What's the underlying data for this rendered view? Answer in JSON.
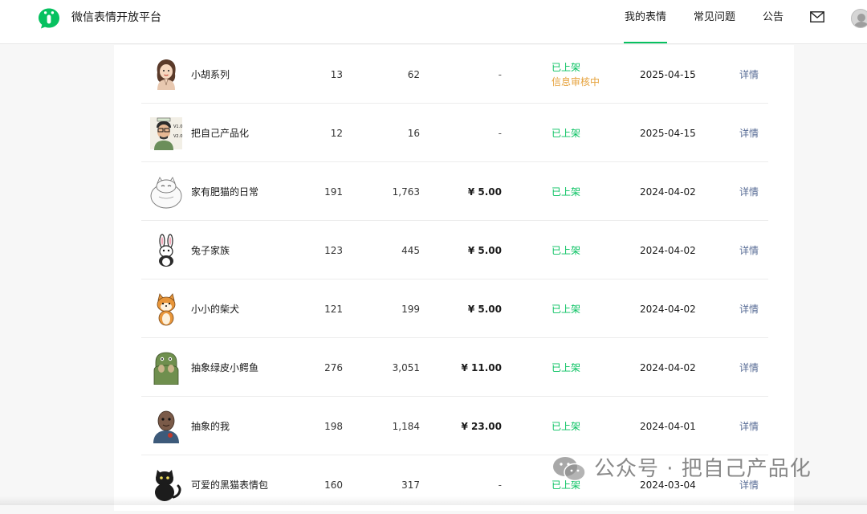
{
  "header": {
    "site_title": "微信表情开放平台",
    "nav": [
      {
        "label": "我的表情",
        "active": true
      },
      {
        "label": "常见问题",
        "active": false
      },
      {
        "label": "公告",
        "active": false
      }
    ],
    "mail_icon": "mail-icon",
    "avatar_icon": "avatar-icon"
  },
  "colors": {
    "brand": "#07c160",
    "status_listed": "#07c160",
    "status_review": "#e6a23c",
    "link": "#576b95"
  },
  "table": {
    "rows": [
      {
        "name": "小胡系列",
        "n1": "13",
        "n2": "62",
        "price": "-",
        "status": "已上架",
        "sub_status": "信息审核中",
        "date": "2025-04-15",
        "action": "详情",
        "thumb_icon": "girl-praying-sticker-icon"
      },
      {
        "name": "把自己产品化",
        "n1": "12",
        "n2": "16",
        "price": "-",
        "status": "已上架",
        "date": "2025-04-15",
        "action": "详情",
        "thumb_icon": "man-with-glasses-sticker-icon"
      },
      {
        "name": "家有肥猫的日常",
        "n1": "191",
        "n2": "1,763",
        "price": "¥ 5.00",
        "status": "已上架",
        "date": "2024-04-02",
        "action": "详情",
        "thumb_icon": "fat-white-cat-sticker-icon"
      },
      {
        "name": "兔子家族",
        "n1": "123",
        "n2": "445",
        "price": "¥ 5.00",
        "status": "已上架",
        "date": "2024-04-02",
        "action": "详情",
        "thumb_icon": "rabbit-sticker-icon"
      },
      {
        "name": "小小的柴犬",
        "n1": "121",
        "n2": "199",
        "price": "¥ 5.00",
        "status": "已上架",
        "date": "2024-04-02",
        "action": "详情",
        "thumb_icon": "shiba-dog-sticker-icon"
      },
      {
        "name": "抽象绿皮小鳄鱼",
        "n1": "276",
        "n2": "3,051",
        "price": "¥ 11.00",
        "status": "已上架",
        "date": "2024-04-02",
        "action": "详情",
        "thumb_icon": "green-crocodile-sticker-icon"
      },
      {
        "name": "抽象的我",
        "n1": "198",
        "n2": "1,184",
        "price": "¥ 23.00",
        "status": "已上架",
        "date": "2024-04-01",
        "action": "详情",
        "thumb_icon": "abstract-me-sticker-icon"
      },
      {
        "name": "可爱的黑猫表情包",
        "n1": "160",
        "n2": "317",
        "price": "-",
        "status": "已上架",
        "date": "2024-03-04",
        "action": "详情",
        "thumb_icon": "black-cat-sticker-icon"
      }
    ]
  },
  "watermark": {
    "text": "公众号 · 把自己产品化",
    "icon": "wechat-icon"
  }
}
